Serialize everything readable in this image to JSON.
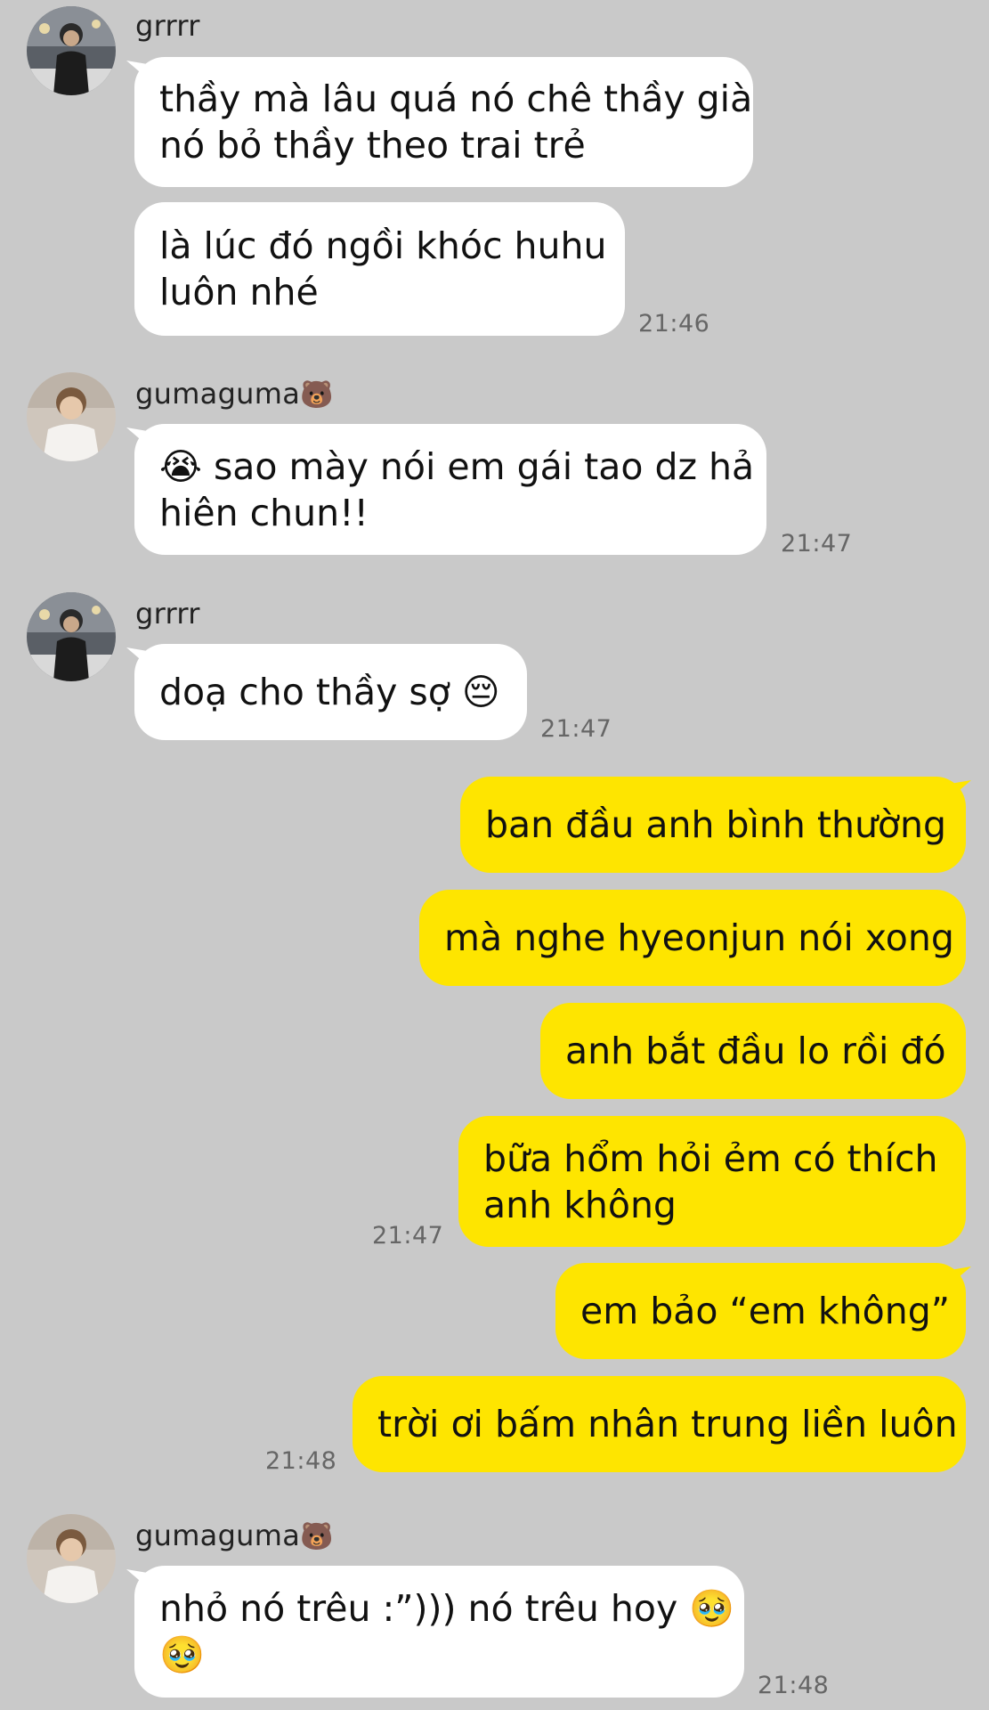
{
  "colors": {
    "background": "#c9c9c9",
    "incoming_bubble": "#ffffff",
    "outgoing_bubble": "#fee500",
    "timestamp": "#666666"
  },
  "senders": {
    "grrrr": {
      "name": "grrrr",
      "icon": "profile-photo"
    },
    "gumaguma": {
      "name": "gumaguma",
      "badge": "🐻",
      "icon": "profile-photo"
    }
  },
  "messages": [
    {
      "sender": "grrrr",
      "direction": "in",
      "lines": [
        "thầy mà lâu quá nó chê thầy già",
        "nó bỏ thầy theo trai trẻ"
      ]
    },
    {
      "sender": "grrrr",
      "direction": "in",
      "lines": [
        "là lúc đó ngồi khóc huhu",
        "luôn nhé"
      ],
      "time": "21:46"
    },
    {
      "sender": "gumaguma",
      "direction": "in",
      "lines": [
        "😭 sao mày nói em gái tao dz hả",
        "hiên chun!!"
      ],
      "time": "21:47"
    },
    {
      "sender": "grrrr",
      "direction": "in",
      "lines": [
        "doạ cho thầy sợ 😔"
      ],
      "time": "21:47"
    },
    {
      "sender": "me",
      "direction": "out",
      "lines": [
        "ban đầu anh bình thường"
      ]
    },
    {
      "sender": "me",
      "direction": "out",
      "lines": [
        "mà nghe hyeonjun nói xong"
      ]
    },
    {
      "sender": "me",
      "direction": "out",
      "lines": [
        "anh bắt đầu lo rồi đó"
      ]
    },
    {
      "sender": "me",
      "direction": "out",
      "lines": [
        "bữa hổm hỏi ẻm có thích",
        "anh không"
      ],
      "time": "21:47"
    },
    {
      "sender": "me",
      "direction": "out",
      "lines": [
        "em bảo “em không”"
      ]
    },
    {
      "sender": "me",
      "direction": "out",
      "lines": [
        "trời ơi bấm nhân trung liền luôn"
      ],
      "time": "21:48"
    },
    {
      "sender": "gumaguma",
      "direction": "in",
      "lines": [
        "nhỏ nó trêu :”))) nó trêu hoy 🥹",
        "🥹"
      ],
      "time": "21:48"
    }
  ]
}
